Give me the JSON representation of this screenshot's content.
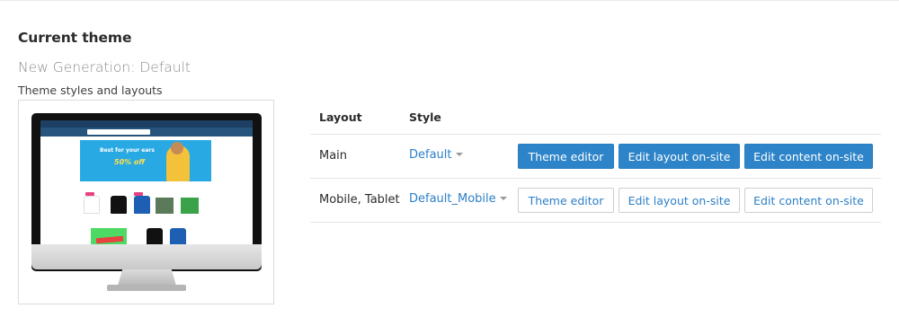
{
  "section": {
    "heading": "Current theme",
    "theme_name": "New Generation: Default",
    "styles_label": "Theme styles and layouts"
  },
  "preview": {
    "banner_line1": "Best for your ears",
    "banner_line2": "50% off"
  },
  "table": {
    "headers": {
      "layout": "Layout",
      "style": "Style"
    },
    "rows": [
      {
        "layout": "Main",
        "style": "Default",
        "buttons": {
          "theme_editor": "Theme editor",
          "edit_layout": "Edit layout on-site",
          "edit_content": "Edit content on-site"
        },
        "button_variant": "primary"
      },
      {
        "layout": "Mobile, Tablet",
        "style": "Default_Mobile",
        "buttons": {
          "theme_editor": "Theme editor",
          "edit_layout": "Edit layout on-site",
          "edit_content": "Edit content on-site"
        },
        "button_variant": "default"
      }
    ]
  },
  "colors": {
    "primary_button": "#2d84c9",
    "link": "#2c7fc7",
    "border": "#cfcfcf"
  },
  "icons": {
    "style_dropdown": "caret-down-icon"
  }
}
